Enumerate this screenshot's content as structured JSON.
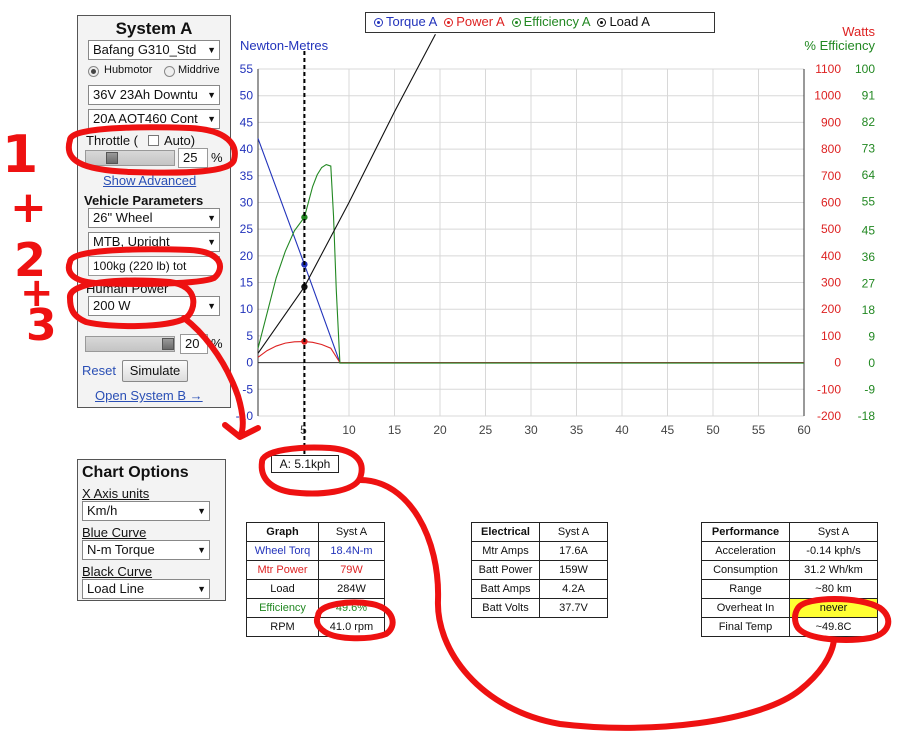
{
  "system_a": {
    "title": "System A",
    "motor": "Bafang G310_Std",
    "drive_options": [
      "Hubmotor",
      "Middrive"
    ],
    "drive_selected": "Hubmotor",
    "battery": "36V 23Ah Downtu",
    "controller": "20A AOT460 Cont",
    "throttle_label": "Throttle (",
    "throttle_auto": "Auto)",
    "throttle_value": "25",
    "percent": "%",
    "show_advanced": "Show Advanced",
    "vehicle_params": "Vehicle Parameters",
    "wheel": "26\"  Wheel",
    "frame": "MTB, Upright",
    "mass": "100kg (220 lb) tot",
    "human_power_label": "Human Power",
    "human_power": "200 W",
    "grade_value": "20",
    "reset": "Reset",
    "simulate": "Simulate",
    "open_b": "Open System B →"
  },
  "chart_options": {
    "title": "Chart Options",
    "x_axis_label": "X Axis units",
    "x_axis": "Km/h",
    "blue_label": "Blue Curve",
    "blue": "N-m Torque",
    "black_label": "Black Curve",
    "black": "Load Line"
  },
  "chart": {
    "legend": [
      "Torque A",
      "Power A",
      "Efficiency A",
      "Load A"
    ],
    "left_axis_title": "Newton-Metres",
    "right_axis_title_1": "Watts",
    "right_axis_title_2": "% Efficiency",
    "x_readout": "A: 5.1kph",
    "colors": {
      "torque": "#2233bb",
      "power": "#dd2222",
      "efficiency": "#228822",
      "load": "#111111",
      "annotation": "#ee1111"
    }
  },
  "chart_data": {
    "type": "line",
    "x_ticks": [
      5,
      10,
      15,
      20,
      25,
      30,
      35,
      40,
      45,
      50,
      55,
      60
    ],
    "y_left_ticks": [
      -5,
      0,
      5,
      10,
      15,
      20,
      25,
      30,
      35,
      40,
      45,
      50,
      55
    ],
    "y_watts_ticks": [
      -200,
      -100,
      0,
      100,
      200,
      300,
      400,
      500,
      600,
      700,
      800,
      900,
      1000,
      1100
    ],
    "y_eff_ticks": [
      -18,
      -9,
      0,
      9,
      18,
      27,
      36,
      45,
      55,
      64,
      73,
      82,
      91,
      100
    ],
    "xlim": [
      0,
      60
    ],
    "ylim_nm": [
      -10,
      55
    ],
    "ylim_watts": [
      -200,
      1100
    ],
    "ylim_eff": [
      -18,
      100
    ],
    "cursor_x": 5.1,
    "series": [
      {
        "name": "Torque A",
        "axis": "nm",
        "x": [
          0,
          5.1,
          9.0,
          60
        ],
        "y": [
          42,
          18.4,
          0,
          0
        ]
      },
      {
        "name": "Power A",
        "axis": "watts",
        "x": [
          0,
          1,
          2,
          3,
          4,
          5.1,
          6,
          7,
          8,
          9,
          60
        ],
        "y": [
          20,
          45,
          62,
          73,
          78,
          79,
          76,
          68,
          54,
          0,
          0
        ]
      },
      {
        "name": "Efficiency A",
        "axis": "eff",
        "x": [
          0,
          1,
          2,
          3,
          4,
          5.1,
          6,
          6.5,
          7,
          7.5,
          8,
          8.3,
          8.6,
          9.0,
          60
        ],
        "y": [
          5,
          17,
          29,
          38,
          45,
          49.6,
          60,
          64,
          66.5,
          67.5,
          67,
          50,
          25,
          0,
          0
        ]
      },
      {
        "name": "Load A",
        "axis": "watts",
        "x": [
          0,
          5.1,
          10,
          15,
          19.5
        ],
        "y": [
          35,
          284,
          600,
          940,
          1230
        ]
      }
    ]
  },
  "results": {
    "graph": {
      "headers": [
        "Graph",
        "Syst A"
      ],
      "rows": [
        [
          "Wheel Torq",
          "18.4N-m"
        ],
        [
          "Mtr Power",
          "79W"
        ],
        [
          "Load",
          "284W"
        ],
        [
          "Efficiency",
          "49.6%"
        ],
        [
          "RPM",
          "41.0 rpm"
        ]
      ]
    },
    "electrical": {
      "headers": [
        "Electrical",
        "Syst A"
      ],
      "rows": [
        [
          "Mtr Amps",
          "17.6A"
        ],
        [
          "Batt Power",
          "159W"
        ],
        [
          "Batt Amps",
          "4.2A"
        ],
        [
          "Batt Volts",
          "37.7V"
        ]
      ]
    },
    "performance": {
      "headers": [
        "Performance",
        "Syst A"
      ],
      "rows": [
        [
          "Acceleration",
          "-0.14 kph/s"
        ],
        [
          "Consumption",
          "31.2 Wh/km"
        ],
        [
          "Range",
          "~80 km"
        ],
        [
          "Overheat In",
          "never"
        ],
        [
          "Final Temp",
          "~49.8C"
        ]
      ]
    }
  },
  "annotations": {
    "glyphs": [
      "1",
      "+",
      "2",
      "+",
      "3"
    ]
  }
}
